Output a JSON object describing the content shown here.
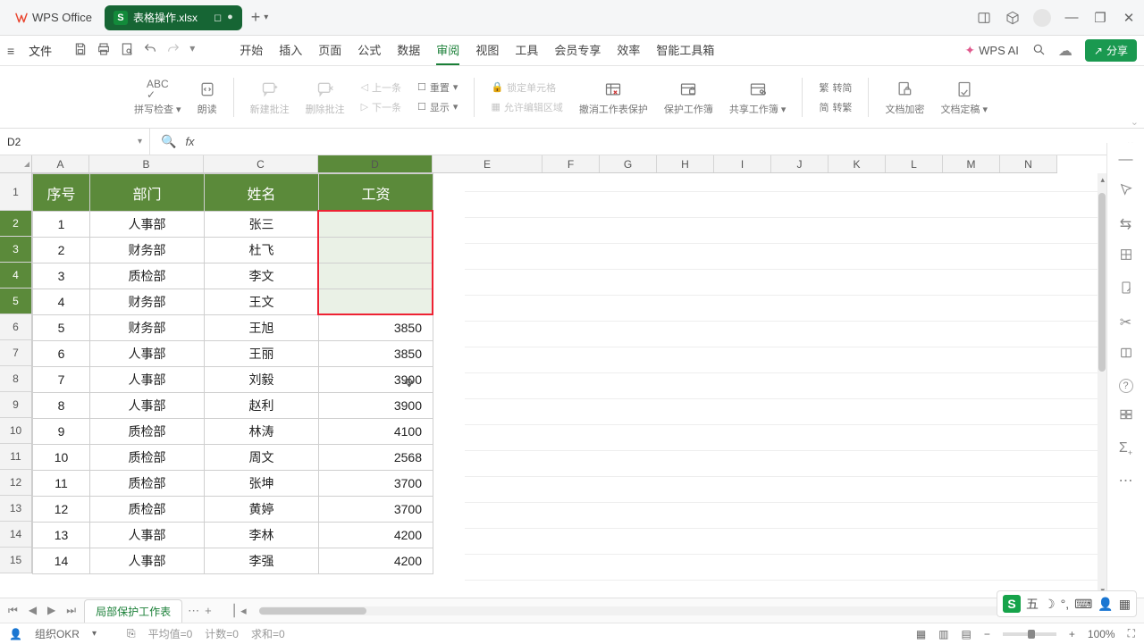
{
  "titlebar": {
    "app_name": "WPS Office",
    "file_tab": {
      "name": "表格操作.xlsx",
      "short_badge": "S",
      "close_glyph": "●",
      "dup_glyph": "◻"
    },
    "new_tab_glyph": "+",
    "right_icons": {
      "box": "⬚",
      "cube": "⬡",
      "min": "—",
      "max": "❐",
      "close": "✕"
    }
  },
  "menubar": {
    "file_label": "文件",
    "tabs": [
      "开始",
      "插入",
      "页面",
      "公式",
      "数据",
      "审阅",
      "视图",
      "工具",
      "会员专享",
      "效率",
      "智能工具箱"
    ],
    "active_tab": "审阅",
    "wps_ai": "WPS AI",
    "share": "分享"
  },
  "ribbon": {
    "spellcheck": "拼写检查",
    "read_aloud": "朗读",
    "new_comment": "新建批注",
    "delete_comment": "删除批注",
    "prev": "上一条",
    "next": "下一条",
    "reset": "重置",
    "show": "显示",
    "lock_cell": "锁定单元格",
    "allow_edit": "允许编辑区域",
    "undo_protect": "撤消工作表保护",
    "protect_workbook": "保护工作簿",
    "share_workbook": "共享工作簿",
    "simp_trad1": "转简",
    "simp_trad2": "转繁",
    "doc_encrypt": "文档加密",
    "doc_finalize": "文档定稿"
  },
  "namebox": {
    "cell": "D2",
    "fx": "fx"
  },
  "columns": [
    "A",
    "B",
    "C",
    "D",
    "E",
    "F",
    "G",
    "H",
    "I",
    "J",
    "K",
    "L",
    "M",
    "N"
  ],
  "headers": {
    "A": "序号",
    "B": "部门",
    "C": "姓名",
    "D": "工资"
  },
  "rows": [
    {
      "n": "1",
      "dept": "人事部",
      "name": "张三",
      "salary": ""
    },
    {
      "n": "2",
      "dept": "财务部",
      "name": "杜飞",
      "salary": ""
    },
    {
      "n": "3",
      "dept": "质检部",
      "name": "李文",
      "salary": ""
    },
    {
      "n": "4",
      "dept": "财务部",
      "name": "王文",
      "salary": ""
    },
    {
      "n": "5",
      "dept": "财务部",
      "name": "王旭",
      "salary": "3850"
    },
    {
      "n": "6",
      "dept": "人事部",
      "name": "王丽",
      "salary": "3850"
    },
    {
      "n": "7",
      "dept": "人事部",
      "name": "刘毅",
      "salary": "3900"
    },
    {
      "n": "8",
      "dept": "人事部",
      "name": "赵利",
      "salary": "3900"
    },
    {
      "n": "9",
      "dept": "质检部",
      "name": "林涛",
      "salary": "4100"
    },
    {
      "n": "10",
      "dept": "质检部",
      "name": "周文",
      "salary": "2568"
    },
    {
      "n": "11",
      "dept": "质检部",
      "name": "张坤",
      "salary": "3700"
    },
    {
      "n": "12",
      "dept": "质检部",
      "name": "黄婷",
      "salary": "3700"
    },
    {
      "n": "13",
      "dept": "人事部",
      "name": "李林",
      "salary": "4200"
    },
    {
      "n": "14",
      "dept": "人事部",
      "name": "李强",
      "salary": "4200"
    }
  ],
  "sheet_tab": "局部保护工作表",
  "statusbar": {
    "okr": "组织OKR",
    "avg": "平均值=0",
    "count": "计数=0",
    "sum": "求和=0",
    "zoom": "100%"
  },
  "ime": {
    "label": "五"
  },
  "side_icons": {
    "minus": "—",
    "cursor": "↖",
    "share": "⇆",
    "sheet": "▦",
    "clip": "✎",
    "tools": "✂",
    "book": "▭",
    "help": "?",
    "images": "▥",
    "sigma": "Σ",
    "more": "⋯"
  }
}
